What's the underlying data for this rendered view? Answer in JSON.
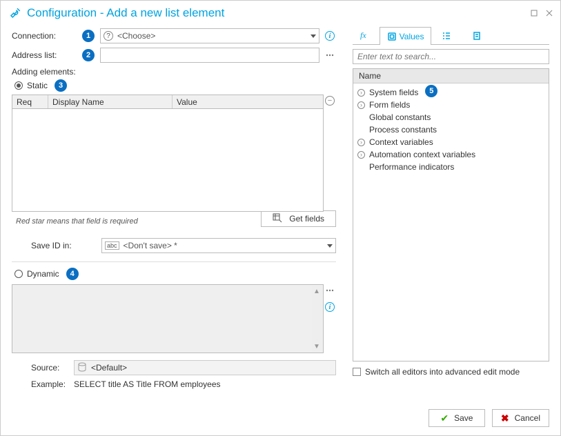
{
  "window": {
    "title": "Configuration - Add a new list element"
  },
  "left": {
    "connection_label": "Connection:",
    "connection_value": "<Choose>",
    "address_label": "Address list:",
    "adding_label": "Adding elements:",
    "static_label": "Static",
    "grid_col_req": "Req",
    "grid_col_display": "Display Name",
    "grid_col_value": "Value",
    "red_star_note": "Red star means that field is required",
    "get_fields_btn": "Get fields",
    "save_in_label": "Save ID in:",
    "save_in_value": "<Don't save> *",
    "dynamic_label": "Dynamic",
    "source_label": "Source:",
    "source_value": "<Default>",
    "example_label": "Example:",
    "example_code": "SELECT title AS Title FROM employees"
  },
  "right": {
    "tab_values": "Values",
    "search_placeholder": "Enter text to search...",
    "tree_header": "Name",
    "items": [
      {
        "label": "System fields",
        "expandable": true
      },
      {
        "label": "Form fields",
        "expandable": true
      },
      {
        "label": "Global constants",
        "expandable": false
      },
      {
        "label": "Process constants",
        "expandable": false
      },
      {
        "label": "Context variables",
        "expandable": true
      },
      {
        "label": "Automation context variables",
        "expandable": true
      },
      {
        "label": "Performance indicators",
        "expandable": false
      }
    ],
    "advanced_mode_label": "Switch all editors into advanced edit mode"
  },
  "badges": {
    "b1": "1",
    "b2": "2",
    "b3": "3",
    "b4": "4",
    "b5": "5"
  },
  "buttons": {
    "save": "Save",
    "cancel": "Cancel"
  }
}
